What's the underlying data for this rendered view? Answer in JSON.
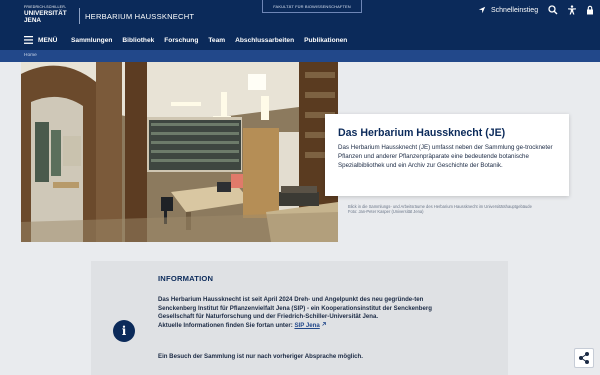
{
  "header": {
    "logo_line1": "FRIEDRICH-SCHILLER-",
    "logo_line2": "UNIVERSITÄT",
    "logo_line3": "JENA",
    "site_title": "HERBARIUM HAUSSKNECHT",
    "faculty_tab": "FAKULTÄT FÜR BIOWISSENSCHAFTEN",
    "quick_access": "Schnelleinstieg"
  },
  "nav": {
    "menu_label": "MENÜ",
    "items": [
      "Sammlungen",
      "Bibliothek",
      "Forschung",
      "Team",
      "Abschlussarbeiten",
      "Publikationen"
    ]
  },
  "breadcrumb": {
    "home": "Home"
  },
  "hero": {
    "title": "Das Herbarium Haussknecht (JE)",
    "text": "Das Herbarium Haussknecht (JE) umfasst neben der Sammlung ge-trockneter Pflanzen und anderer Pflanzenpräparate eine bedeutende botanische Spezialbibliothek und ein Archiv zur Geschichte der Botanik.",
    "caption_line1": "Blick in die Sammlungs- und Arbeitsräume des Herbarium Haussknecht im Universitätshauptgebäude",
    "caption_line2": "Foto: Jan-Peter Kasper (Universität Jena)"
  },
  "info": {
    "heading": "INFORMATION",
    "body": "Das Herbarium Haussknecht ist seit April 2024 Dreh- und Angelpunkt des neu gegründe-ten Senckenberg Institut für Pflanzenvielfalt Jena (SIP) - ein Kooperationsinstitut der Senckenberg Gesellschaft für Naturforschung und der Friedrich-Schiller-Universität Jena.",
    "more_prefix": "Aktuelle Informationen finden Sie fortan unter: ",
    "more_link": "SIP Jena",
    "visit": "Ein Besuch der Sammlung ist nur nach vorheriger Absprache möglich.",
    "icon_glyph": "i"
  },
  "colors": {
    "primary": "#0b2a5a",
    "breadcrumb_bar": "#22488a",
    "info_box": "#dfe1e4"
  }
}
